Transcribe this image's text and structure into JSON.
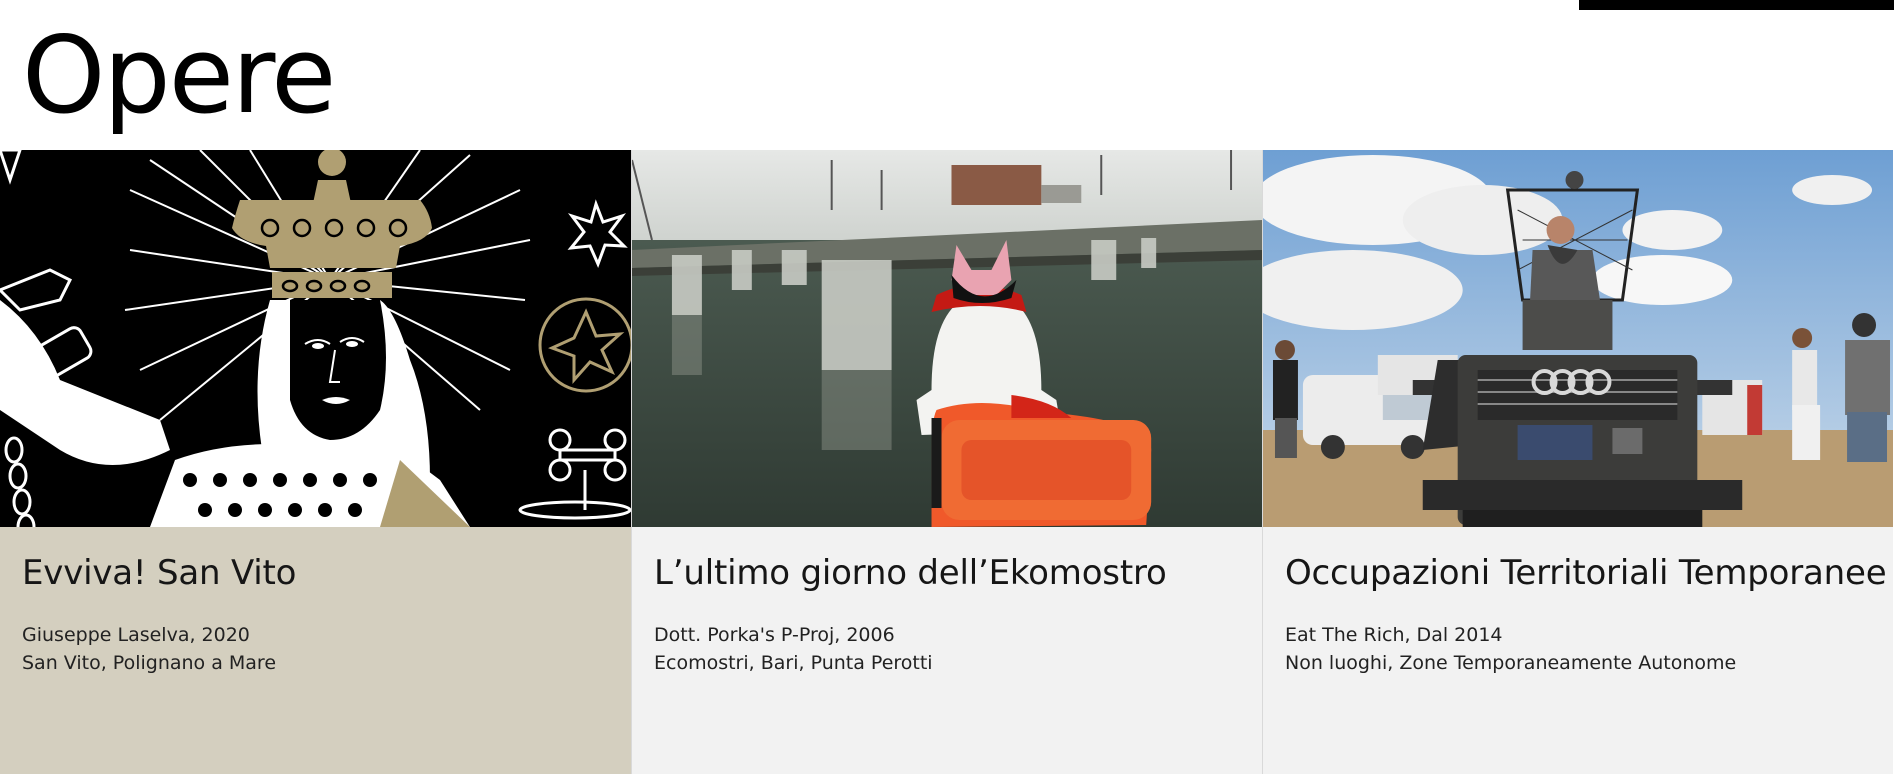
{
  "page": {
    "title": "Opere"
  },
  "cards": [
    {
      "title": "Evviva! San Vito",
      "meta_line1": "Giuseppe Laselva, 2020",
      "meta_line2": "San Vito, Polignano a Mare",
      "bg_color": "#d4cfbf",
      "image": "illustration-saint-crown"
    },
    {
      "title": "L’ultimo giorno dell’Ekomostro",
      "meta_line1": "Dott. Porka's P-Proj, 2006",
      "meta_line2": "Ecomostri, Bari, Punta Perotti",
      "bg_color": "#f2f2f2",
      "image": "photo-figure-on-water"
    },
    {
      "title": "Occupazioni Territoriali Temporanee",
      "meta_line1": "Eat The Rich, Dal 2014",
      "meta_line2": "Non luoghi, Zone Temporaneamente Autonome",
      "bg_color": "#f2f2f2",
      "image": "photo-mad-max-vehicle"
    }
  ],
  "colors": {
    "accent_gold": "#b09f72",
    "black": "#000000"
  }
}
